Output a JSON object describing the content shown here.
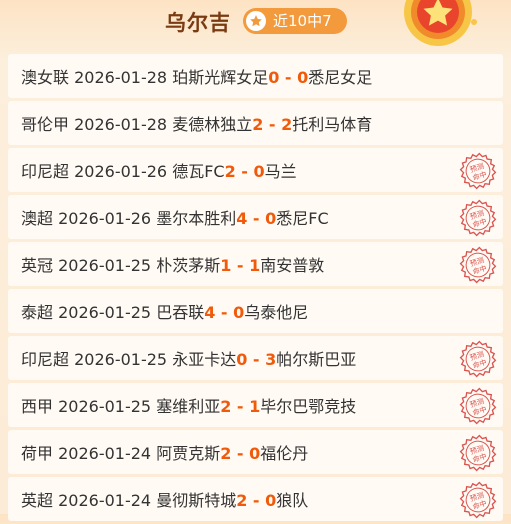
{
  "header": {
    "title": "乌尔吉",
    "badge_label": "近10中7",
    "badge_icon": "star-icon",
    "medal_icon": "medal-icon"
  },
  "colors": {
    "accent": "#f05a0a",
    "badge": "#f39a3c",
    "title": "#7a3b12",
    "stamp": "#d9534f"
  },
  "stamp_text": "预测命中",
  "matches": [
    {
      "league": "澳女联",
      "date": "2026-01-28",
      "home": "珀斯光辉女足",
      "hs": "0",
      "sep": "-",
      "as": "0",
      "away": "悉尼女足",
      "hit": false
    },
    {
      "league": "哥伦甲",
      "date": "2026-01-28",
      "home": "麦德林独立",
      "hs": "2",
      "sep": "-",
      "as": "2",
      "away": "托利马体育",
      "hit": false
    },
    {
      "league": "印尼超",
      "date": "2026-01-26",
      "home": "德瓦FC",
      "hs": "2",
      "sep": "-",
      "as": "0",
      "away": "马兰",
      "hit": true
    },
    {
      "league": "澳超",
      "date": "2026-01-26",
      "home": "墨尔本胜利",
      "hs": "4",
      "sep": "-",
      "as": "0",
      "away": "悉尼FC",
      "hit": true
    },
    {
      "league": "英冠",
      "date": "2026-01-25",
      "home": "朴茨茅斯",
      "hs": "1",
      "sep": "-",
      "as": "1",
      "away": "南安普敦",
      "hit": true
    },
    {
      "league": "泰超",
      "date": "2026-01-25",
      "home": "巴吞联",
      "hs": "4",
      "sep": "-",
      "as": "0",
      "away": "乌泰他尼",
      "hit": false
    },
    {
      "league": "印尼超",
      "date": "2026-01-25",
      "home": "永亚卡达",
      "hs": "0",
      "sep": "-",
      "as": "3",
      "away": "帕尔斯巴亚",
      "hit": true
    },
    {
      "league": "西甲",
      "date": "2026-01-25",
      "home": "塞维利亚",
      "hs": "2",
      "sep": "-",
      "as": "1",
      "away": "毕尔巴鄂竞技",
      "hit": true
    },
    {
      "league": "荷甲",
      "date": "2026-01-24",
      "home": "阿贾克斯",
      "hs": "2",
      "sep": "-",
      "as": "0",
      "away": "福伦丹",
      "hit": true
    },
    {
      "league": "英超",
      "date": "2026-01-24",
      "home": "曼彻斯特城",
      "hs": "2",
      "sep": "-",
      "as": "0",
      "away": "狼队",
      "hit": true
    }
  ]
}
